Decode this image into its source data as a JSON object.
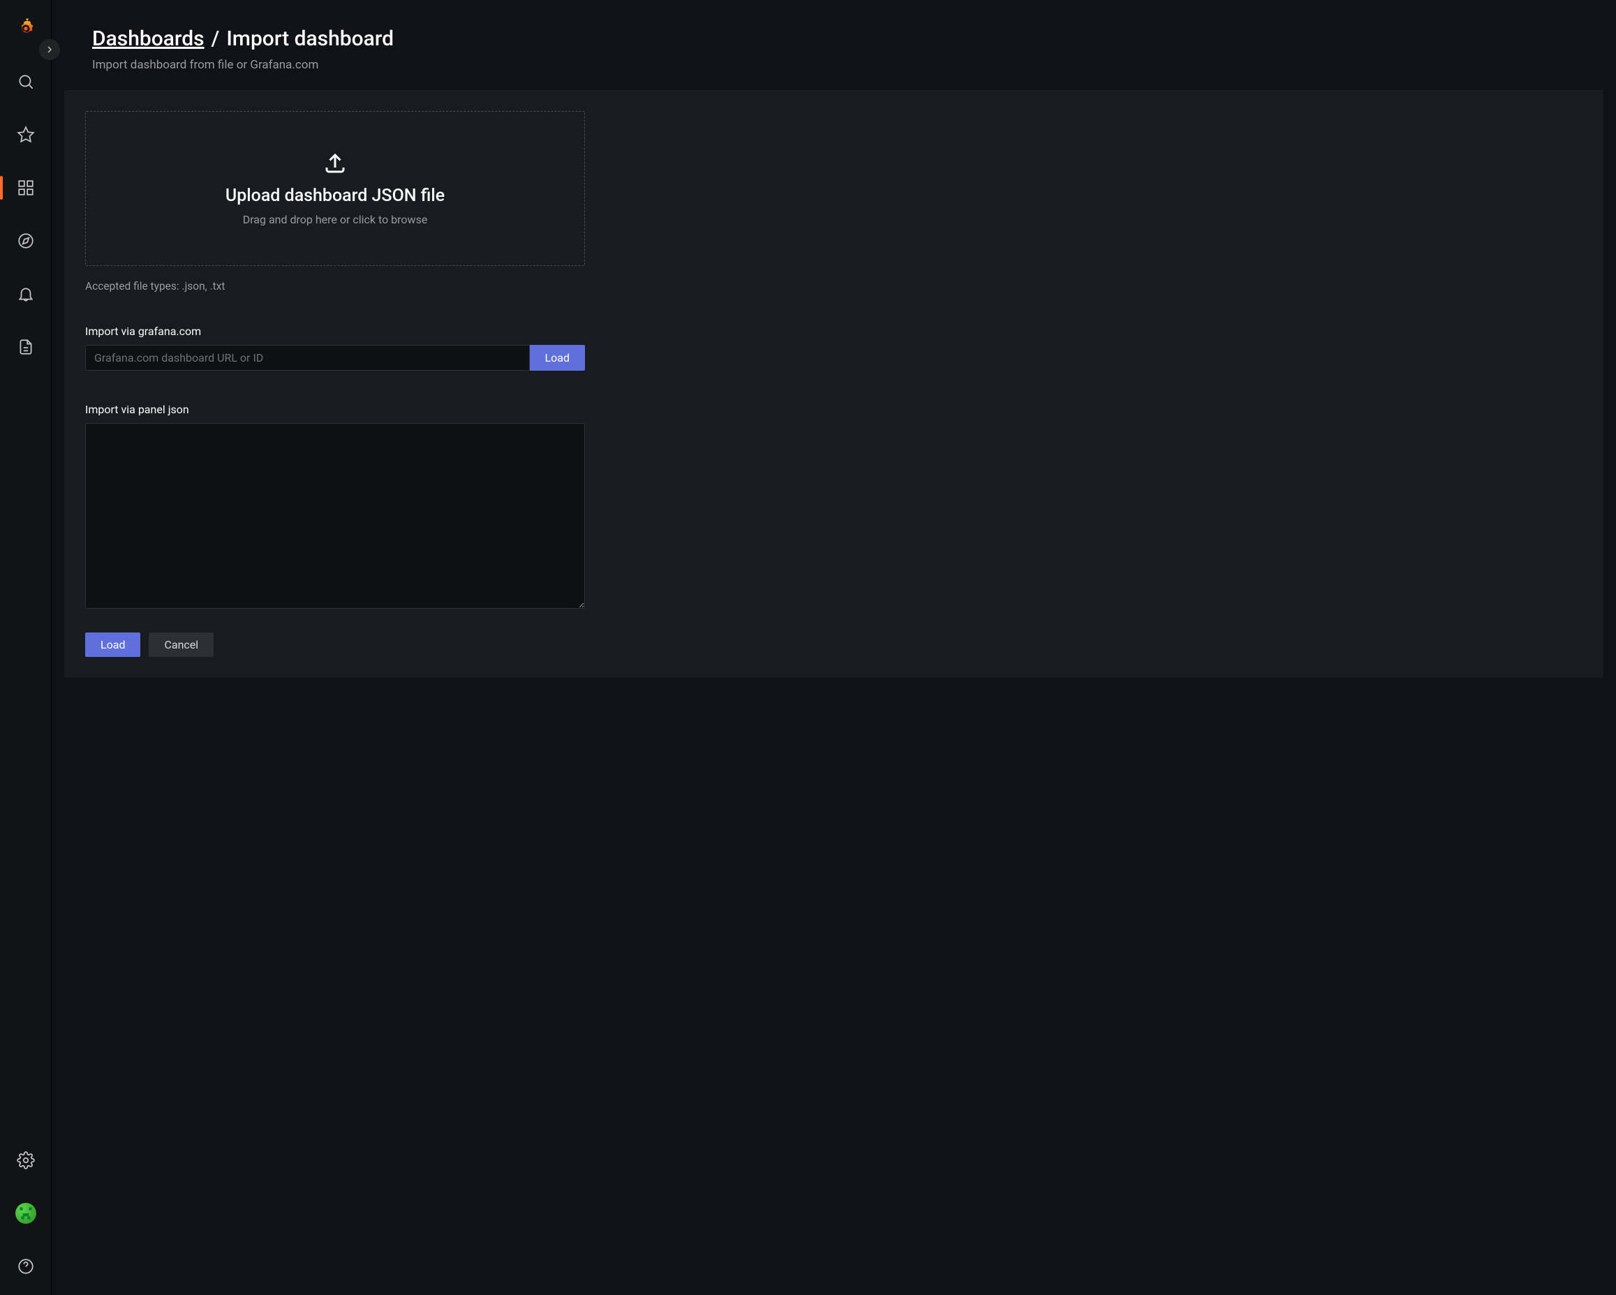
{
  "breadcrumb": {
    "parent": "Dashboards",
    "current": "Import dashboard"
  },
  "subtitle": "Import dashboard from file or Grafana.com",
  "dropzone": {
    "title": "Upload dashboard JSON file",
    "hint": "Drag and drop here or click to browse"
  },
  "accepted_hint": "Accepted file types: .json, .txt",
  "grafana_import": {
    "label": "Import via grafana.com",
    "placeholder": "Grafana.com dashboard URL or ID",
    "button": "Load"
  },
  "json_import": {
    "label": "Import via panel json"
  },
  "actions": {
    "load": "Load",
    "cancel": "Cancel"
  },
  "nav": {
    "items": [
      "logo",
      "search",
      "starred",
      "dashboards",
      "explore",
      "alerting",
      "connections"
    ],
    "bottom": [
      "admin",
      "profile",
      "help"
    ]
  }
}
